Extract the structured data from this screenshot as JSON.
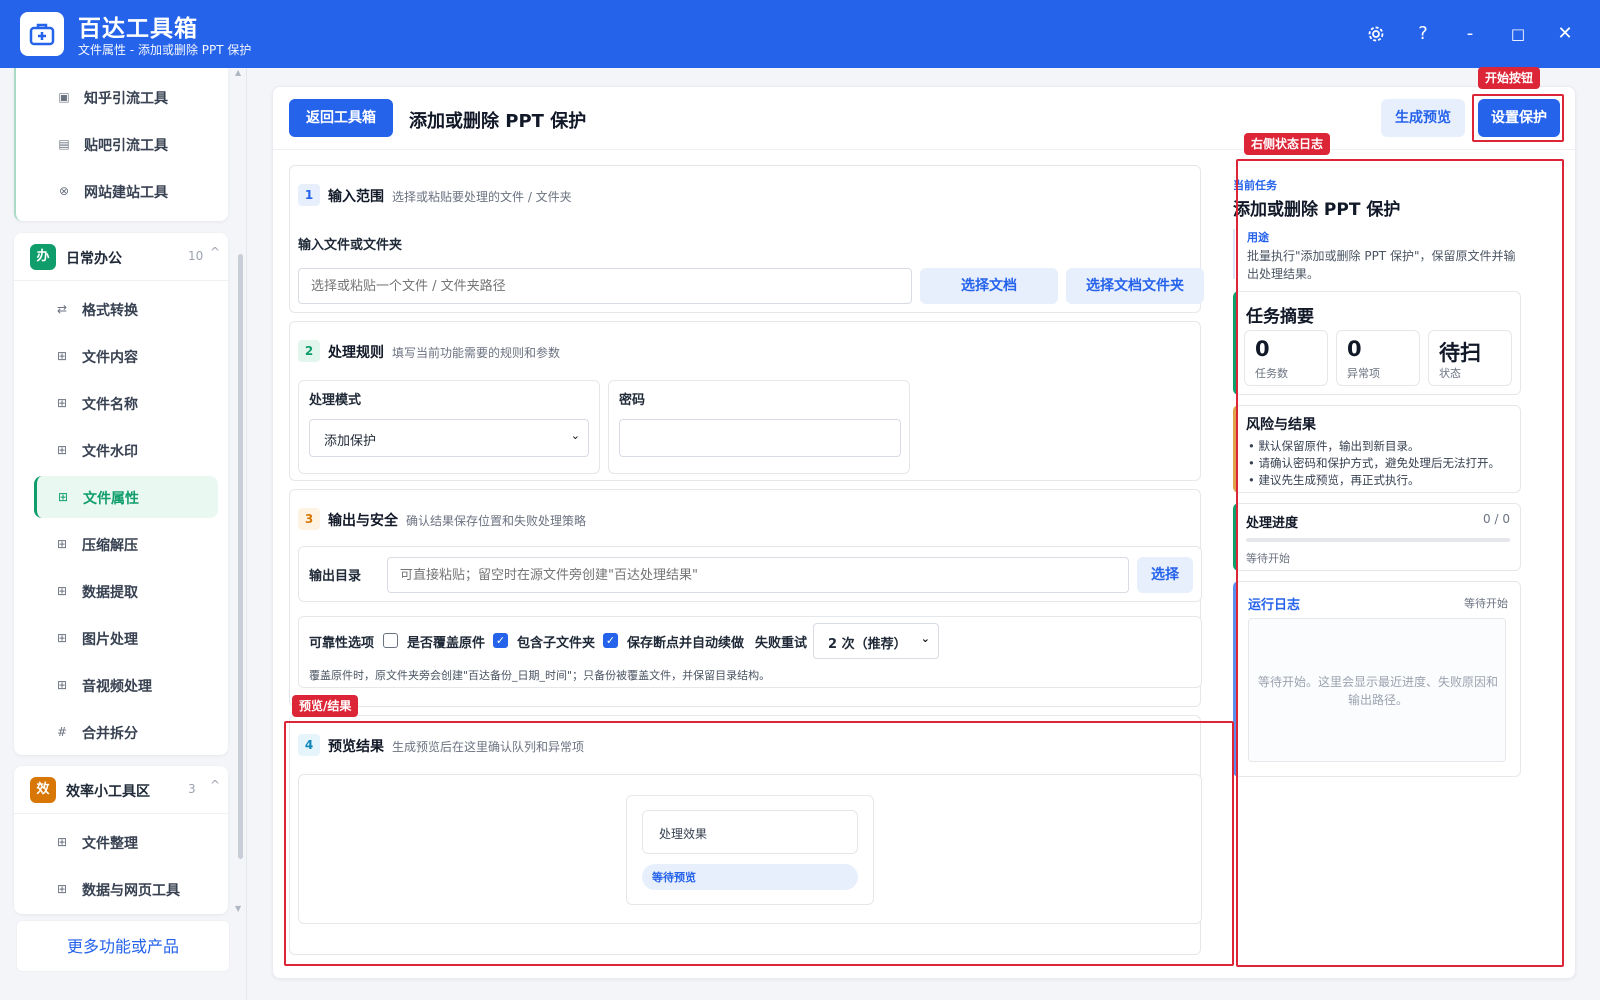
{
  "window": {
    "title": "百达工具箱",
    "subtitle": "文件属性 - 添加或删除 PPT 保护",
    "settings_icon": "gear-icon",
    "help_label": "?",
    "minimize_label": "-",
    "maximize_label": "□",
    "close_label": "✕"
  },
  "sidebar": {
    "top_items": [
      {
        "label": "知乎引流工具",
        "icon": "zhihu-icon"
      },
      {
        "label": "贴吧引流工具",
        "icon": "tieba-icon"
      },
      {
        "label": "网站建站工具",
        "icon": "globe-icon"
      }
    ],
    "groups": [
      {
        "badge": "办",
        "name": "日常办公",
        "count": "10",
        "color": "#0f9d6b",
        "items": [
          {
            "label": "格式转换",
            "icon": "swap-icon"
          },
          {
            "label": "文件内容",
            "icon": "grid-icon"
          },
          {
            "label": "文件名称",
            "icon": "grid-icon"
          },
          {
            "label": "文件水印",
            "icon": "grid-icon"
          },
          {
            "label": "文件属性",
            "icon": "grid-icon",
            "active": true
          },
          {
            "label": "压缩解压",
            "icon": "grid-icon"
          },
          {
            "label": "数据提取",
            "icon": "grid-icon"
          },
          {
            "label": "图片处理",
            "icon": "grid-icon"
          },
          {
            "label": "音视频处理",
            "icon": "grid-icon"
          },
          {
            "label": "合并拆分",
            "icon": "hash-icon"
          }
        ]
      },
      {
        "badge": "效",
        "name": "效率小工具区",
        "count": "3",
        "color": "#d97706",
        "items": [
          {
            "label": "文件整理",
            "icon": "grid-icon"
          },
          {
            "label": "数据与网页工具",
            "icon": "grid-icon"
          }
        ]
      }
    ],
    "more_label": "更多功能或产品"
  },
  "main": {
    "back_label": "返回工具箱",
    "page_title": "添加或删除 PPT 保护",
    "preview_label": "生成预览",
    "start_label": "设置保护",
    "sections": {
      "input": {
        "num": "1",
        "title": "输入范围",
        "desc": "选择或粘贴要处理的文件 / 文件夹",
        "field_label": "输入文件或文件夹",
        "placeholder": "选择或粘贴一个文件 / 文件夹路径",
        "choose_file": "选择文档",
        "choose_folder": "选择文档文件夹"
      },
      "rules": {
        "num": "2",
        "title": "处理规则",
        "desc": "填写当前功能需要的规则和参数",
        "mode_label": "处理模式",
        "mode_value": "添加保护",
        "password_label": "密码",
        "password_value": ""
      },
      "output": {
        "num": "3",
        "title": "输出与安全",
        "desc": "确认结果保存位置和失败处理策略",
        "dir_label": "输出目录",
        "dir_placeholder": "可直接粘贴；留空时在源文件旁创建\"百达处理结果\"",
        "choose_label": "选择",
        "reliability_label": "可靠性选项",
        "overwrite_label": "是否覆盖原件",
        "overwrite_checked": false,
        "subfolder_label": "包含子文件夹",
        "subfolder_checked": true,
        "resume_label": "保存断点并自动续做",
        "resume_checked": true,
        "retry_label": "失败重试",
        "retry_value": "2 次（推荐）",
        "note": "覆盖原件时，原文件夹旁会创建\"百达备份_日期_时间\"；只备份被覆盖文件，并保留目录结构。"
      },
      "preview": {
        "num": "4",
        "title": "预览结果",
        "desc": "生成预览后在这里确认队列和异常项",
        "effect_label": "处理效果",
        "status_label": "等待预览"
      }
    }
  },
  "right_panel": {
    "current_caption": "当前任务",
    "task_title": "添加或删除 PPT 保护",
    "purpose_caption": "用途",
    "purpose_text": "批量执行\"添加或删除 PPT 保护\"，保留原文件并输出处理结果。",
    "summary": {
      "title": "任务摘要",
      "stats": [
        {
          "value": "0",
          "label": "任务数"
        },
        {
          "value": "0",
          "label": "异常项"
        },
        {
          "value": "待扫",
          "label": "状态"
        }
      ]
    },
    "risk": {
      "title": "风险与结果",
      "bullets": [
        "默认保留原件，输出到新目录。",
        "请确认密码和保护方式，避免处理后无法打开。",
        "建议先生成预览，再正式执行。"
      ]
    },
    "progress": {
      "title": "处理进度",
      "count": "0 / 0",
      "value": 0,
      "status": "等待开始"
    },
    "log": {
      "title": "运行日志",
      "status": "等待开始",
      "placeholder": "等待开始。这里会显示最近进度、失败原因和输出路径。"
    }
  },
  "annotations": {
    "start_button": "开始按钮",
    "status_log": "右侧状态日志",
    "preview_result": "预览/结果"
  },
  "colors": {
    "brand": "#2563eb",
    "annotation": "#dc2637",
    "active_green": "#0f9d6b"
  }
}
